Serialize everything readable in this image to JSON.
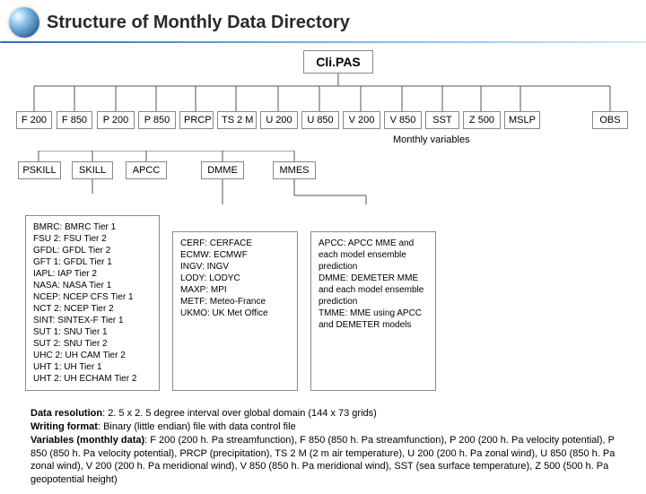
{
  "header": {
    "title": "Structure of Monthly Data Directory"
  },
  "root": "Cli.PAS",
  "variables": [
    "F 200",
    "F 850",
    "P 200",
    "P 850",
    "PRCP",
    "TS 2 M",
    "U 200",
    "U 850",
    "V 200",
    "V 850",
    "SST",
    "Z 500",
    "MSLP"
  ],
  "obs": "OBS",
  "monthly_label": "Monthly variables",
  "second_root_ref": "PRCP",
  "secondary": [
    "PSKILL",
    "SKILL",
    "APCC",
    "DMME",
    "MMES"
  ],
  "box_left": [
    "BMRC: BMRC Tier 1",
    "FSU 2: FSU Tier 2",
    "GFDL: GFDL Tier 2",
    "GFT 1: GFDL Tier 1",
    "IAPL: IAP Tier 2",
    "NASA: NASA Tier 1",
    "NCEP: NCEP CFS Tier 1",
    "NCT 2: NCEP Tier 2",
    "SINT: SINTEX-F Tier 1",
    "SUT 1: SNU Tier 1",
    "SUT 2: SNU Tier 2",
    "UHC 2: UH CAM Tier 2",
    "UHT 1: UH Tier 1",
    "UHT 2: UH ECHAM Tier 2"
  ],
  "box_mid": [
    "CERF: CERFACE",
    "ECMW: ECMWF",
    "INGV: INGV",
    "LODY: LODYC",
    "MAXP: MPI",
    "METF: Meteo-France",
    "UKMO: UK Met Office"
  ],
  "box_right": [
    "APCC: APCC MME and each model ensemble prediction",
    "DMME: DEMETER MME and each model ensemble prediction",
    "TMME: MME using APCC and DEMETER models"
  ],
  "notes": {
    "line1_label": "Data resolution",
    "line1_text": ": 2. 5 x 2. 5 degree interval over global domain (144 x 73 grids)",
    "line2_label": "Writing format",
    "line2_text": ": Binary (little endian) file with data control file",
    "line3_label": "Variables (monthly data)",
    "line3_text": ": F 200 (200 h. Pa streamfunction), F 850 (850 h. Pa streamfunction), P 200 (200 h. Pa velocity potential), P 850 (850 h. Pa velocity potential), PRCP (precipitation), TS 2 M (2 m air temperature), U 200 (200 h. Pa zonal wind), U 850 (850 h. Pa zonal wind), V 200 (200 h. Pa meridional wind), V 850 (850 h. Pa meridional wind), SST (sea surface temperature), Z 500 (500 h. Pa geopotential height)"
  }
}
